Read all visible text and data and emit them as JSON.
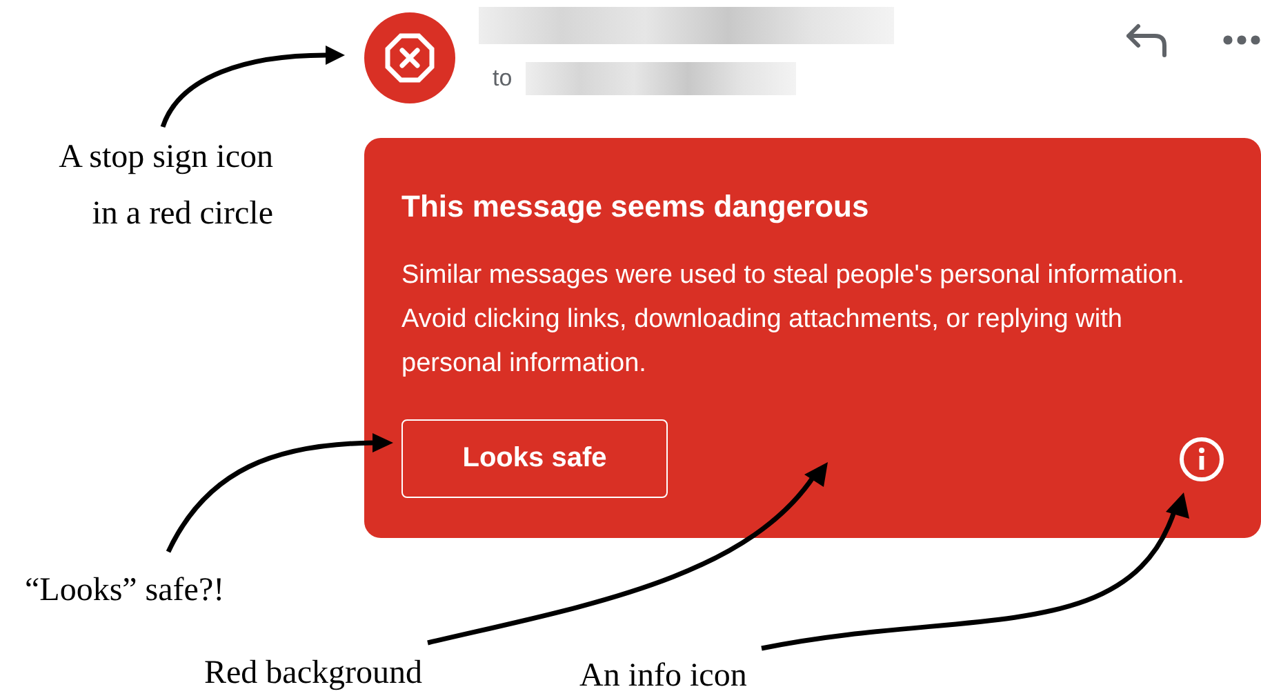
{
  "header": {
    "recipient_prefix": "to"
  },
  "warning": {
    "title": "This message seems dangerous",
    "body": "Similar messages were used to steal people's personal information. Avoid clicking links, downloading attachments, or replying with personal information.",
    "button": "Looks safe"
  },
  "annotations": [
    {
      "lines": [
        "A stop sign icon",
        "in a red circle"
      ]
    },
    {
      "lines": [
        "“Looks” safe?!"
      ]
    },
    {
      "lines": [
        "Red background"
      ]
    },
    {
      "lines": [
        "An info icon"
      ]
    }
  ]
}
